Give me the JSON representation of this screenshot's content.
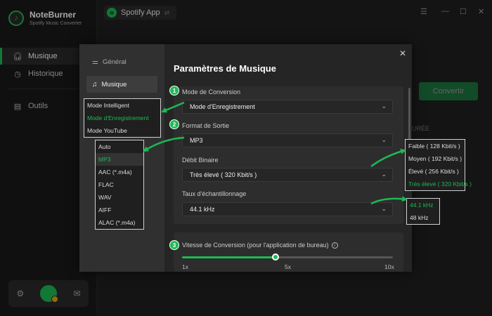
{
  "app": {
    "name": "NoteBurner",
    "subtitle": "Spotify Music Converter"
  },
  "sidebar": {
    "items": [
      {
        "label": "Musique",
        "icon": "headphones-icon"
      },
      {
        "label": "Historique",
        "icon": "clock-icon"
      },
      {
        "label": "Outils",
        "icon": "toolbox-icon"
      }
    ]
  },
  "topbar": {
    "source_label": "Spotify App",
    "switch_icon": "switch-icon"
  },
  "background": {
    "convert_label": "Convertir",
    "duration_label": "URÉE"
  },
  "dialog": {
    "tabs": [
      {
        "label": "Général",
        "icon": "sliders-icon"
      },
      {
        "label": "Musique",
        "icon": "music-note-icon"
      }
    ],
    "title": "Paramètres de Musique",
    "conversion_mode": {
      "step": "1",
      "label": "Mode de Conversion",
      "value": "Mode d'Enregistrement",
      "options": [
        "Mode Intelligent",
        "Mode d'Enregistrement",
        "Mode YouTube"
      ]
    },
    "output_format": {
      "step": "2",
      "label": "Format de Sortie",
      "value": "MP3",
      "options": [
        "Auto",
        "MP3",
        "AAC (*.m4a)",
        "FLAC",
        "WAV",
        "AIFF",
        "ALAC (*.m4a)"
      ]
    },
    "bitrate": {
      "label": "Débit Binaire",
      "value": "Très élevé ( 320 Kbit/s )",
      "options": [
        "Faible ( 128 Kbit/s )",
        "Moyen ( 192 Kbit/s )",
        "Élevé ( 256 Kbit/s )",
        "Très élevé ( 320 Kbit/s )"
      ]
    },
    "sample_rate": {
      "label": "Taux d'échantillonnage",
      "value": "44.1 kHz",
      "options": [
        "44.1 kHz",
        "48 kHz"
      ]
    },
    "speed": {
      "step": "3",
      "label": "Vitesse de Conversion (pour l'application de bureau)",
      "ticks": [
        "1x",
        "5x",
        "10x"
      ],
      "value": 5,
      "min": 1,
      "max": 10
    }
  },
  "colors": {
    "accent": "#1db954",
    "background": "#1f1f1f",
    "panel": "#2d2d2d"
  }
}
